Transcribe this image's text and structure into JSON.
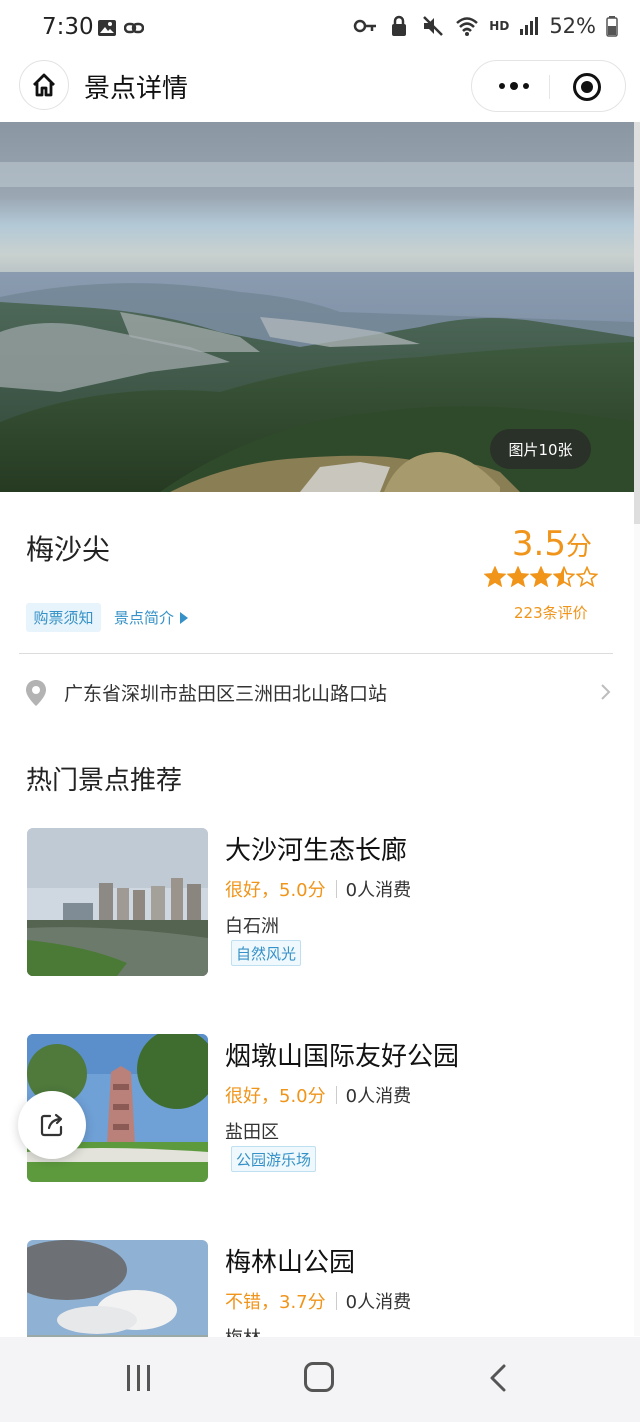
{
  "status_bar": {
    "time": "7:30",
    "battery": "52%",
    "network_label": "HD",
    "icons": [
      "image-icon",
      "link-icon",
      "key-icon",
      "lock-icon",
      "mute-icon",
      "wifi-icon",
      "signal-icon",
      "battery-icon"
    ]
  },
  "nav": {
    "title": "景点详情",
    "home_icon": "home-icon",
    "more_icon": "more-dots-icon",
    "target_icon": "target-icon"
  },
  "hero": {
    "photo_count": "图片10张"
  },
  "spot": {
    "name": "梅沙尖",
    "score": "3.5",
    "score_unit": "分",
    "stars": 3.5,
    "review_count": "223条评价",
    "ticket_notice": "购票须知",
    "intro_link": "景点简介",
    "address": "广东省深圳市盐田区三洲田北山路口站"
  },
  "recommend": {
    "title": "热门景点推荐",
    "items": [
      {
        "name": "大沙河生态长廊",
        "rating": "很好，5.0分",
        "consume": "0人消费",
        "area": "白石洲",
        "tag": "自然风光"
      },
      {
        "name": "烟墩山国际友好公园",
        "rating": "很好，5.0分",
        "consume": "0人消费",
        "area": "盐田区",
        "tag": "公园游乐场"
      },
      {
        "name": "梅林山公园",
        "rating": "不错，3.7分",
        "consume": "0人消费",
        "area": "梅林",
        "tag": ""
      }
    ]
  },
  "colors": {
    "accent_orange": "#f0941a",
    "link_blue": "#3591c7",
    "tag_bg": "#eef8fd"
  }
}
